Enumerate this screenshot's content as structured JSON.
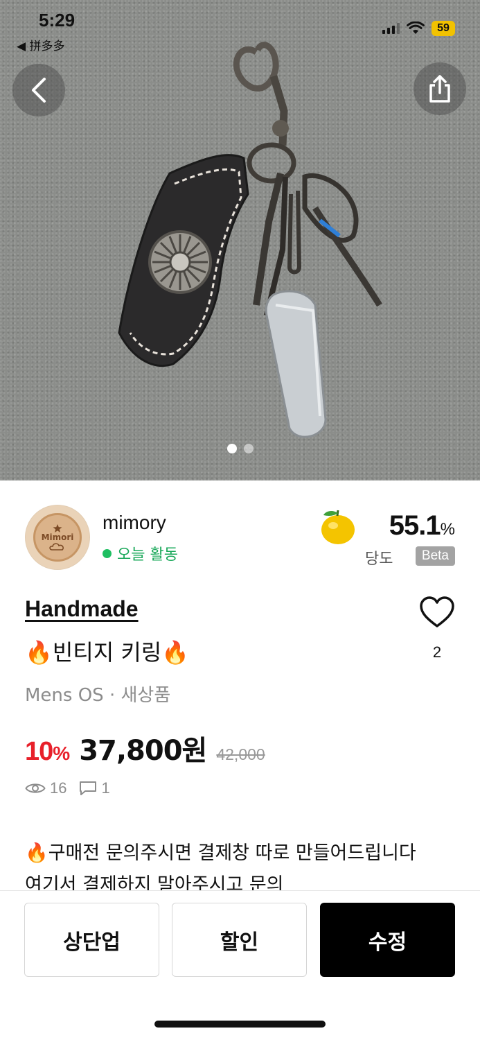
{
  "status_bar": {
    "time": "5:29",
    "back_app_label": "◀ 拼多多",
    "battery": "59"
  },
  "hero": {
    "image_count": 2,
    "active_index": 0
  },
  "seller": {
    "name": "mimory",
    "activity": "오늘 활동",
    "avatar_text": "Mimori",
    "temperature": "55.1",
    "temperature_unit": "%",
    "temperature_label": "당도",
    "beta_label": "Beta"
  },
  "product": {
    "brand": "Handmade",
    "title": "🔥빈티지 키링🔥",
    "meta": "Mens OS · 새상품",
    "discount": "10",
    "discount_unit": "%",
    "price": "37,800원",
    "original_price": "42,000",
    "likes": "2",
    "views": "16",
    "comments": "1",
    "description_lines": [
      "🔥구매전 문의주시면 결제창 따로 만들어드립니다",
      "여기서 결제하지 말아주시고 문의"
    ]
  },
  "actions": {
    "bump_label": "상단업",
    "discount_label": "할인",
    "edit_label": "수정"
  },
  "colors": {
    "discount_red": "#e8202a",
    "active_green": "#1aa85a",
    "beta_gray": "#a3a3a3",
    "primary_button": "#000000"
  },
  "icons": [
    "back-arrow-icon",
    "share-icon",
    "heart-icon",
    "eye-icon",
    "comment-icon",
    "fruit-icon",
    "wifi-icon",
    "signal-icon"
  ]
}
